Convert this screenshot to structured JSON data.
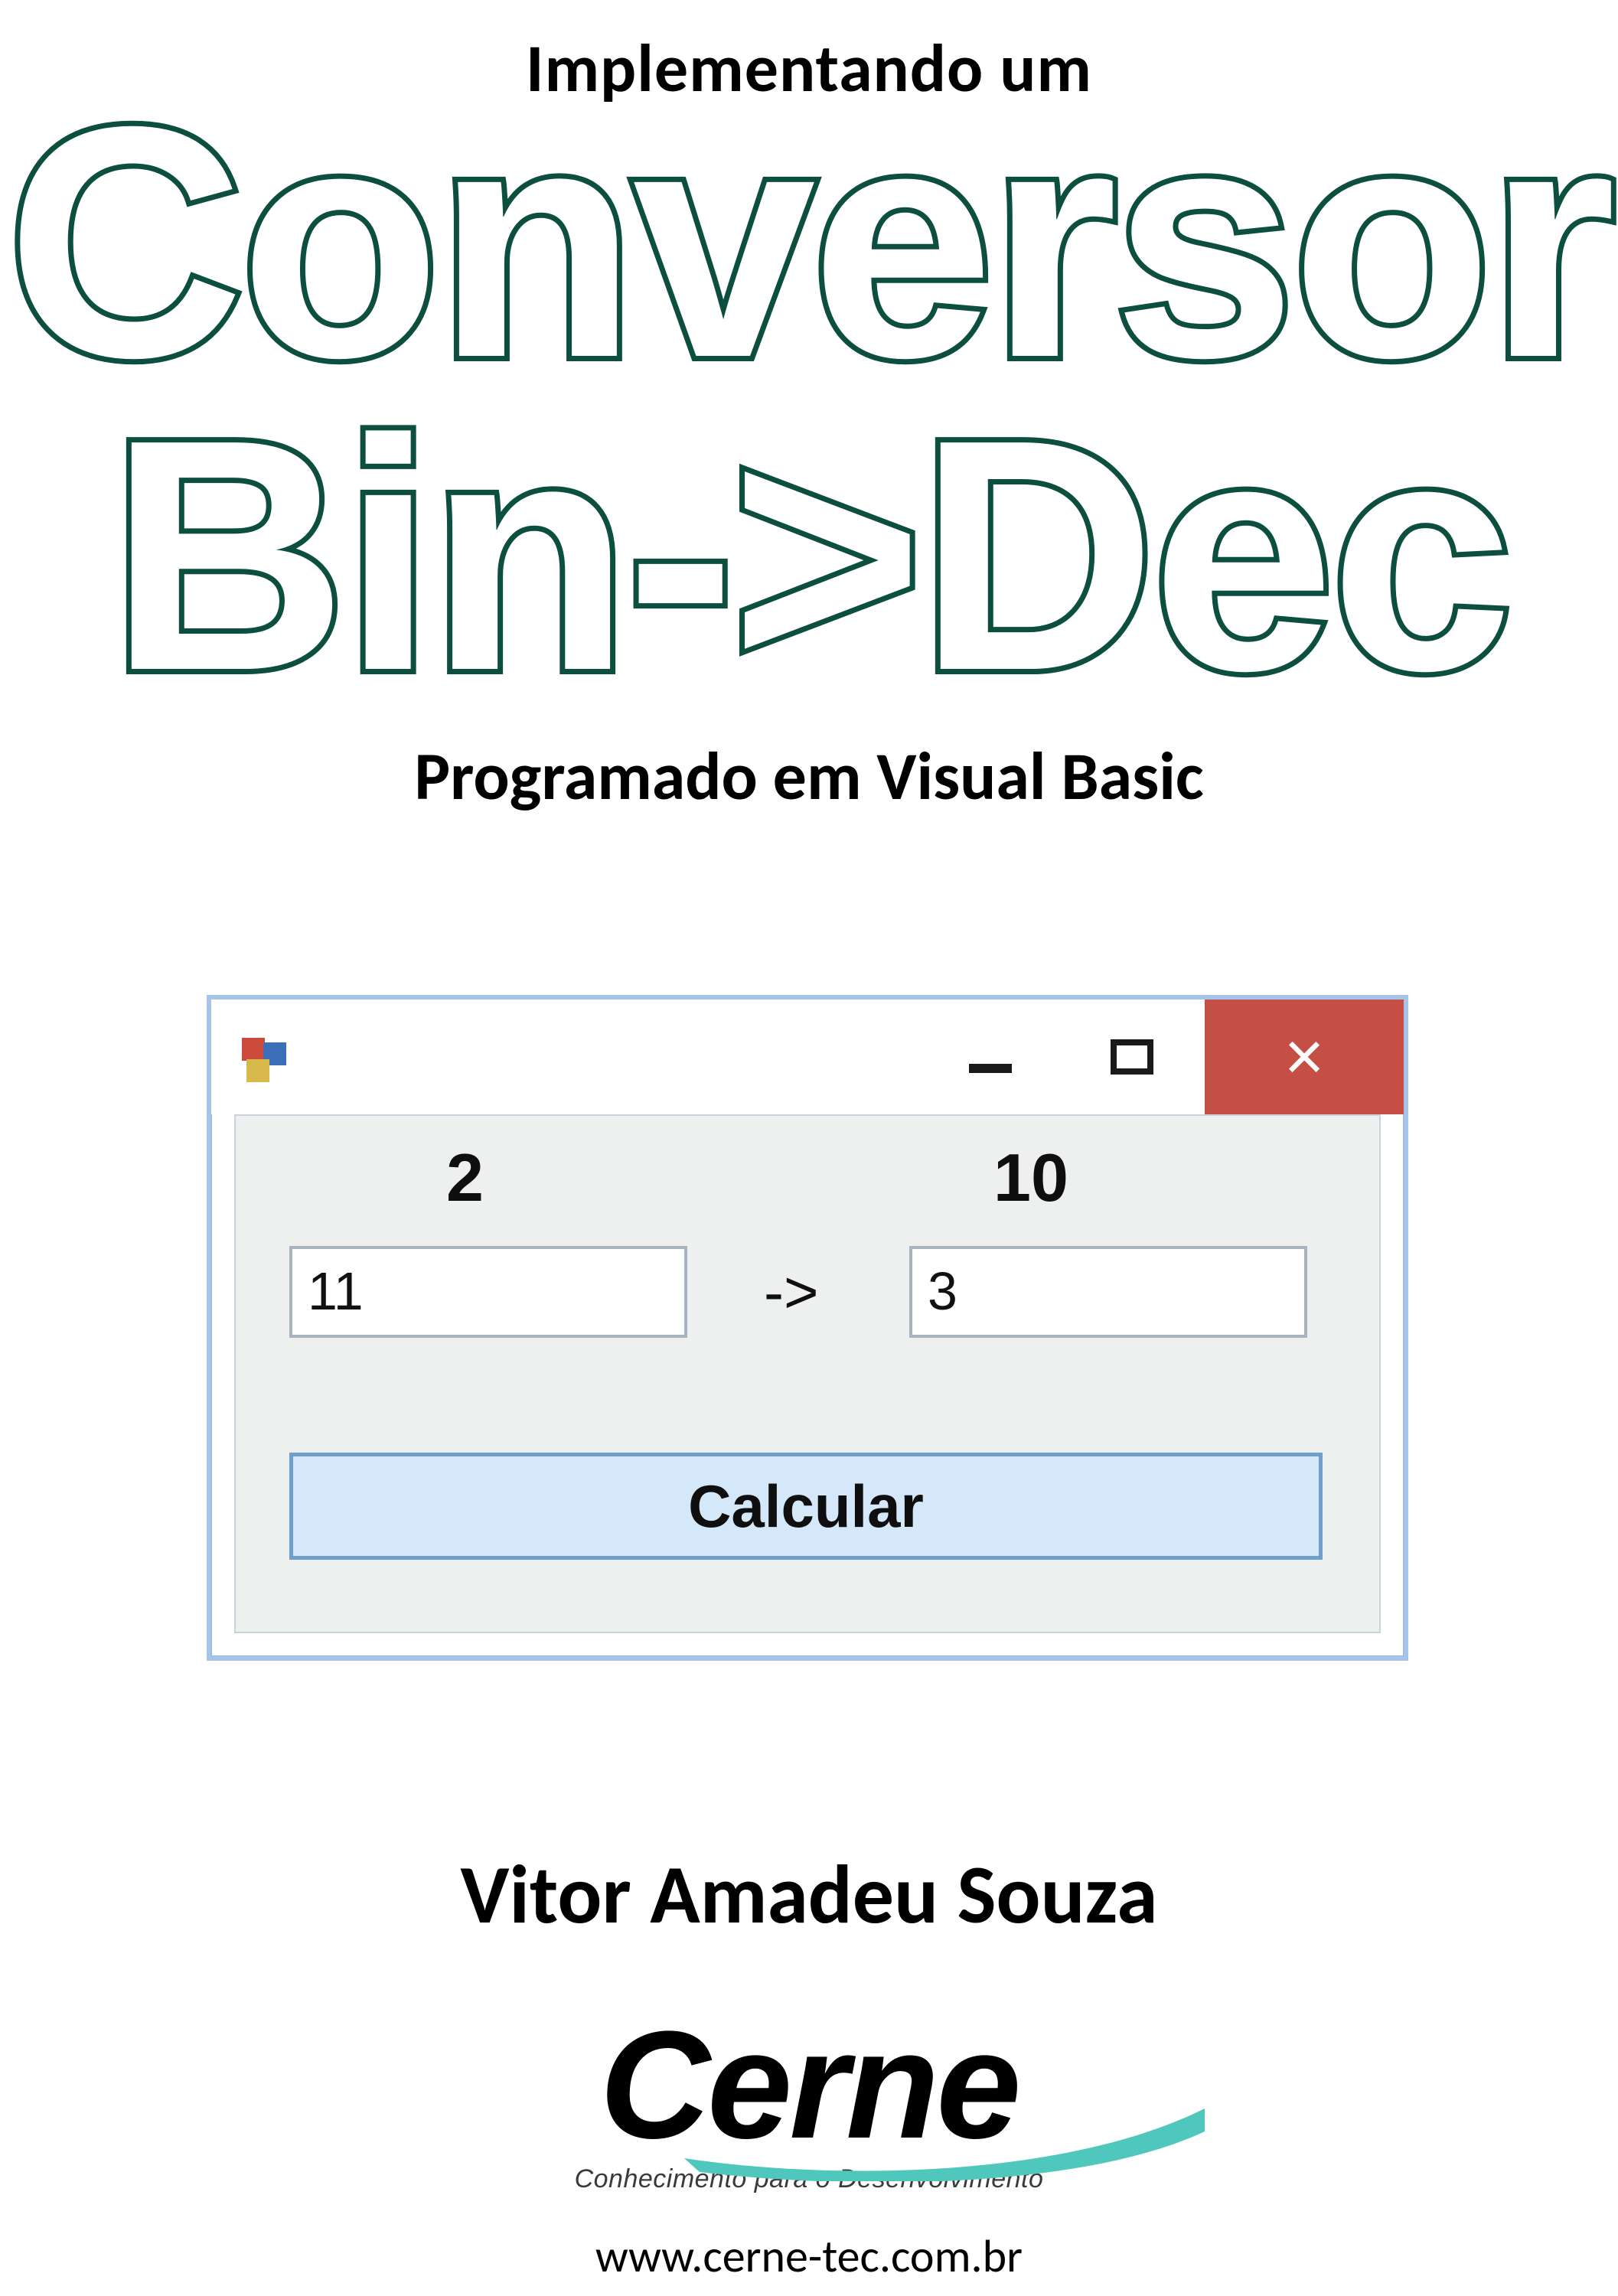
{
  "title": {
    "super": "Implementando um",
    "line1": "Conversor",
    "line2": "Bin->Dec",
    "sub": "Programado em Visual Basic"
  },
  "form": {
    "label_base_in": "2",
    "label_base_out": "10",
    "input_value": "11",
    "output_value": "3",
    "arrow": "->",
    "button_label": "Calcular"
  },
  "author": "Vitor Amadeu Souza",
  "logo": {
    "brand": "Cerne",
    "tagline": "Conhecimento para o Desenvolvimento",
    "url": "www.cerne-tec.com.br"
  },
  "colors": {
    "title_outline": "#0d4f3f",
    "window_border": "#a5c4e8",
    "close_bg": "#c54f44",
    "client_bg": "#eef0f0",
    "button_bg": "#d5e8f9",
    "button_border": "#709fca",
    "swoosh": "#4fc7bd"
  }
}
